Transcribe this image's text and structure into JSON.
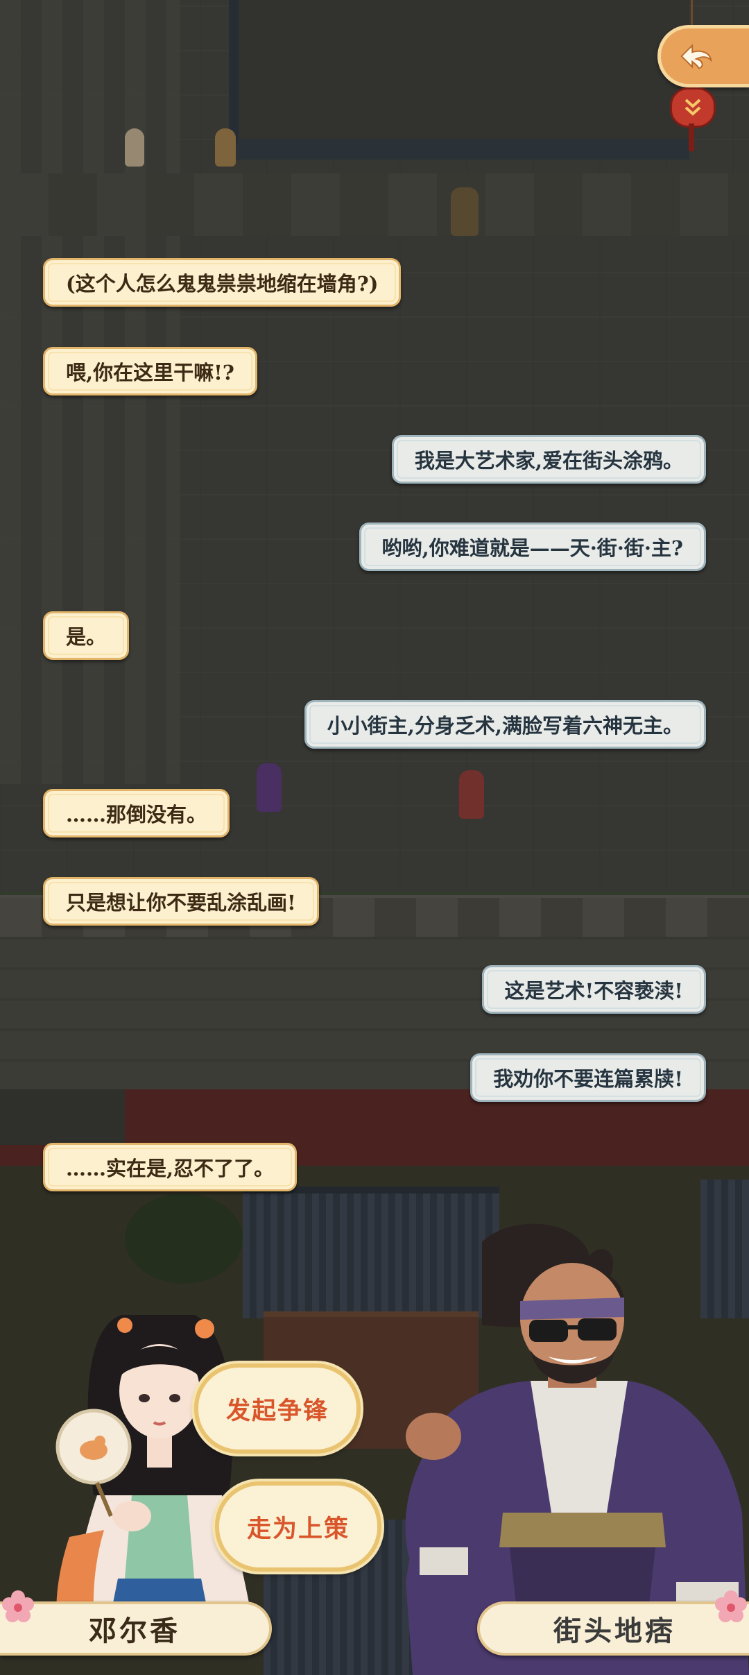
{
  "dialogue": [
    {
      "side": "left",
      "text": "(这个人怎么鬼鬼祟祟地缩在墙角?)"
    },
    {
      "side": "left",
      "text": "喂,你在这里干嘛!?"
    },
    {
      "side": "right",
      "text": "我是大艺术家,爱在街头涂鸦。"
    },
    {
      "side": "right",
      "text": "哟哟,你难道就是——天·街·街·主?"
    },
    {
      "side": "left",
      "text": "是。"
    },
    {
      "side": "right",
      "text": "小小街主,分身乏术,满脸写着六神无主。"
    },
    {
      "side": "left",
      "text": "……那倒没有。"
    },
    {
      "side": "left",
      "text": "只是想让你不要乱涂乱画!"
    },
    {
      "side": "right",
      "text": "这是艺术!不容亵渎!"
    },
    {
      "side": "right",
      "text": "我劝你不要连篇累牍!"
    },
    {
      "side": "left",
      "text": "……实在是,忍不了了。"
    }
  ],
  "choices": {
    "first": "发起争锋",
    "second": "走为上策"
  },
  "characters": {
    "left_name": "邓尔香",
    "right_name": "街头地痞"
  },
  "controls": {
    "back_icon": "swirl-cloud-back-icon",
    "lantern_icon": "double-chevron-down-icon"
  },
  "colors": {
    "left_bubble": "#fdf0cf",
    "right_bubble": "#e8ebe8",
    "choice_text": "#d9552a",
    "accent_gold": "#e9c36f"
  }
}
